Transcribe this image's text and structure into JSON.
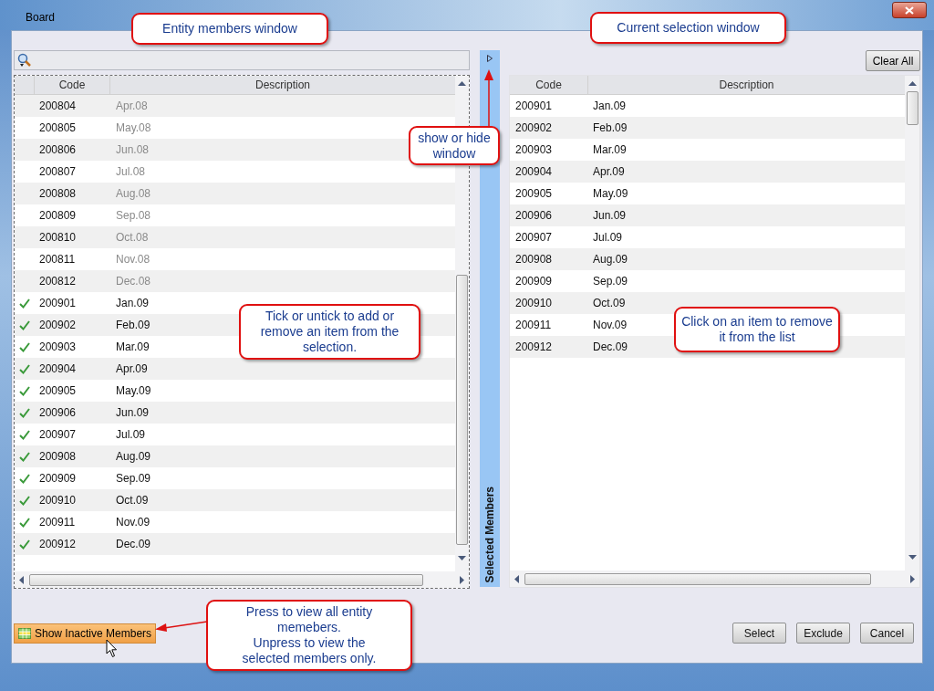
{
  "window": {
    "title": "Board"
  },
  "members_panel": {
    "columns": [
      "Code",
      "Description"
    ],
    "rows": [
      {
        "code": "200804",
        "description": "Apr.08",
        "checked": false,
        "active": false
      },
      {
        "code": "200805",
        "description": "May.08",
        "checked": false,
        "active": false
      },
      {
        "code": "200806",
        "description": "Jun.08",
        "checked": false,
        "active": false
      },
      {
        "code": "200807",
        "description": "Jul.08",
        "checked": false,
        "active": false
      },
      {
        "code": "200808",
        "description": "Aug.08",
        "checked": false,
        "active": false
      },
      {
        "code": "200809",
        "description": "Sep.08",
        "checked": false,
        "active": false
      },
      {
        "code": "200810",
        "description": "Oct.08",
        "checked": false,
        "active": false
      },
      {
        "code": "200811",
        "description": "Nov.08",
        "checked": false,
        "active": false
      },
      {
        "code": "200812",
        "description": "Dec.08",
        "checked": false,
        "active": false
      },
      {
        "code": "200901",
        "description": "Jan.09",
        "checked": true,
        "active": true
      },
      {
        "code": "200902",
        "description": "Feb.09",
        "checked": true,
        "active": true
      },
      {
        "code": "200903",
        "description": "Mar.09",
        "checked": true,
        "active": true
      },
      {
        "code": "200904",
        "description": "Apr.09",
        "checked": true,
        "active": true
      },
      {
        "code": "200905",
        "description": "May.09",
        "checked": true,
        "active": true
      },
      {
        "code": "200906",
        "description": "Jun.09",
        "checked": true,
        "active": true
      },
      {
        "code": "200907",
        "description": "Jul.09",
        "checked": true,
        "active": true
      },
      {
        "code": "200908",
        "description": "Aug.09",
        "checked": true,
        "active": true
      },
      {
        "code": "200909",
        "description": "Sep.09",
        "checked": true,
        "active": true
      },
      {
        "code": "200910",
        "description": "Oct.09",
        "checked": true,
        "active": true
      },
      {
        "code": "200911",
        "description": "Nov.09",
        "checked": true,
        "active": true
      },
      {
        "code": "200912",
        "description": "Dec.09",
        "checked": true,
        "active": true
      }
    ]
  },
  "side_strip": {
    "label": "Selected Members"
  },
  "selection_panel": {
    "clear_button": "Clear All",
    "columns": [
      "Code",
      "Description"
    ],
    "rows": [
      {
        "code": "200901",
        "description": "Jan.09"
      },
      {
        "code": "200902",
        "description": "Feb.09"
      },
      {
        "code": "200903",
        "description": "Mar.09"
      },
      {
        "code": "200904",
        "description": "Apr.09"
      },
      {
        "code": "200905",
        "description": "May.09"
      },
      {
        "code": "200906",
        "description": "Jun.09"
      },
      {
        "code": "200907",
        "description": "Jul.09"
      },
      {
        "code": "200908",
        "description": "Aug.09"
      },
      {
        "code": "200909",
        "description": "Sep.09"
      },
      {
        "code": "200910",
        "description": "Oct.09"
      },
      {
        "code": "200911",
        "description": "Nov.09"
      },
      {
        "code": "200912",
        "description": "Dec.09"
      }
    ]
  },
  "inactive_button": {
    "label": "Show Inactive Members",
    "pressed": true
  },
  "buttons": [
    "Select",
    "Exclude",
    "Cancel"
  ],
  "callouts": [
    {
      "text": "Entity members window"
    },
    {
      "text": "Current selection window"
    },
    {
      "text": "show or hide window"
    },
    {
      "text": "Tick or untick to add or remove an item from the selection."
    },
    {
      "text": "Click on an item to remove it from the list"
    },
    {
      "text": "Press to view all entity memebers.\nUnpress to view the selected members only."
    }
  ]
}
